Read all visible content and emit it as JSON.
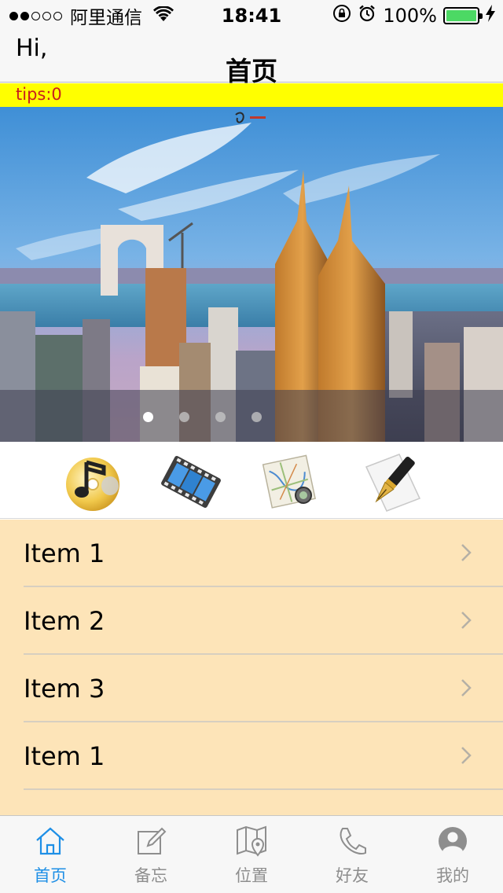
{
  "status_bar": {
    "carrier": "阿里通信",
    "time": "18:41",
    "battery_text": "100%",
    "battery_level": 1.0,
    "signal_bars_filled": 2,
    "signal_bars_total": 5
  },
  "nav": {
    "greeting": "Hi,",
    "title": "首页"
  },
  "tips": {
    "text": "tips:0",
    "background": "#ffff00"
  },
  "banner": {
    "page_count": 4,
    "current_page": 1
  },
  "shortcuts": [
    {
      "icon": "music-cd-icon"
    },
    {
      "icon": "film-icon"
    },
    {
      "icon": "map-icon"
    },
    {
      "icon": "pen-icon"
    }
  ],
  "list": {
    "background": "#fde4b8",
    "items": [
      {
        "label": "Item 1"
      },
      {
        "label": "Item 2"
      },
      {
        "label": "Item 3"
      },
      {
        "label": "Item 1"
      }
    ]
  },
  "tab_bar": {
    "accent": "#1e8fe6",
    "tabs": [
      {
        "label": "首页",
        "icon": "home-icon",
        "active": true
      },
      {
        "label": "备忘",
        "icon": "memo-icon",
        "active": false
      },
      {
        "label": "位置",
        "icon": "location-map-icon",
        "active": false
      },
      {
        "label": "好友",
        "icon": "phone-icon",
        "active": false
      },
      {
        "label": "我的",
        "icon": "profile-icon",
        "active": false
      }
    ]
  }
}
